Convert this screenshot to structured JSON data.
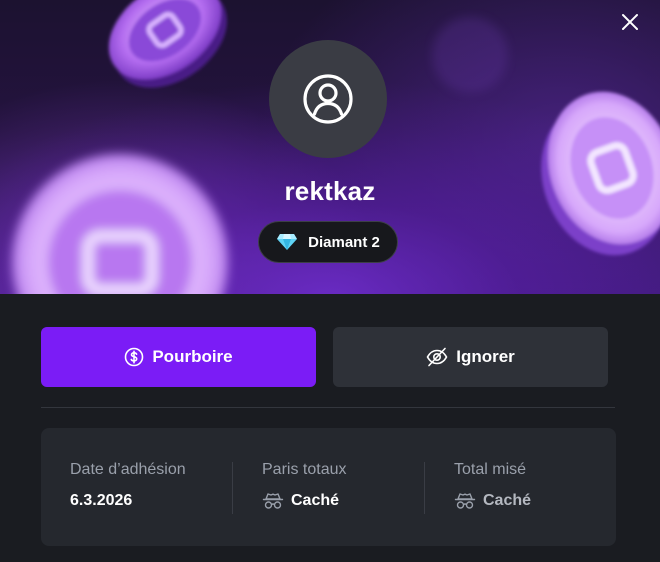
{
  "profile": {
    "username": "rektkaz",
    "rank": "Diamant 2"
  },
  "actions": {
    "tip_label": "Pourboire",
    "ignore_label": "Ignorer"
  },
  "stats": [
    {
      "label": "Date d’adhésion",
      "value": "6.3.2026",
      "icon": ""
    },
    {
      "label": "Paris totaux",
      "value": "Caché",
      "icon": "incognito-icon"
    },
    {
      "label": "Total misé",
      "value": "Caché",
      "icon": "incognito-icon"
    }
  ],
  "icons": {
    "close": "close-icon",
    "avatar": "user-icon",
    "rank": "diamond-icon",
    "tip": "dollar-coin-icon",
    "ignore": "eye-slash-icon"
  },
  "colors": {
    "accent": "#7b1cf6",
    "background": "#1a1c21",
    "card": "#25282e",
    "secondary_button": "#2e3138",
    "diamond": "#5fd3f5"
  }
}
